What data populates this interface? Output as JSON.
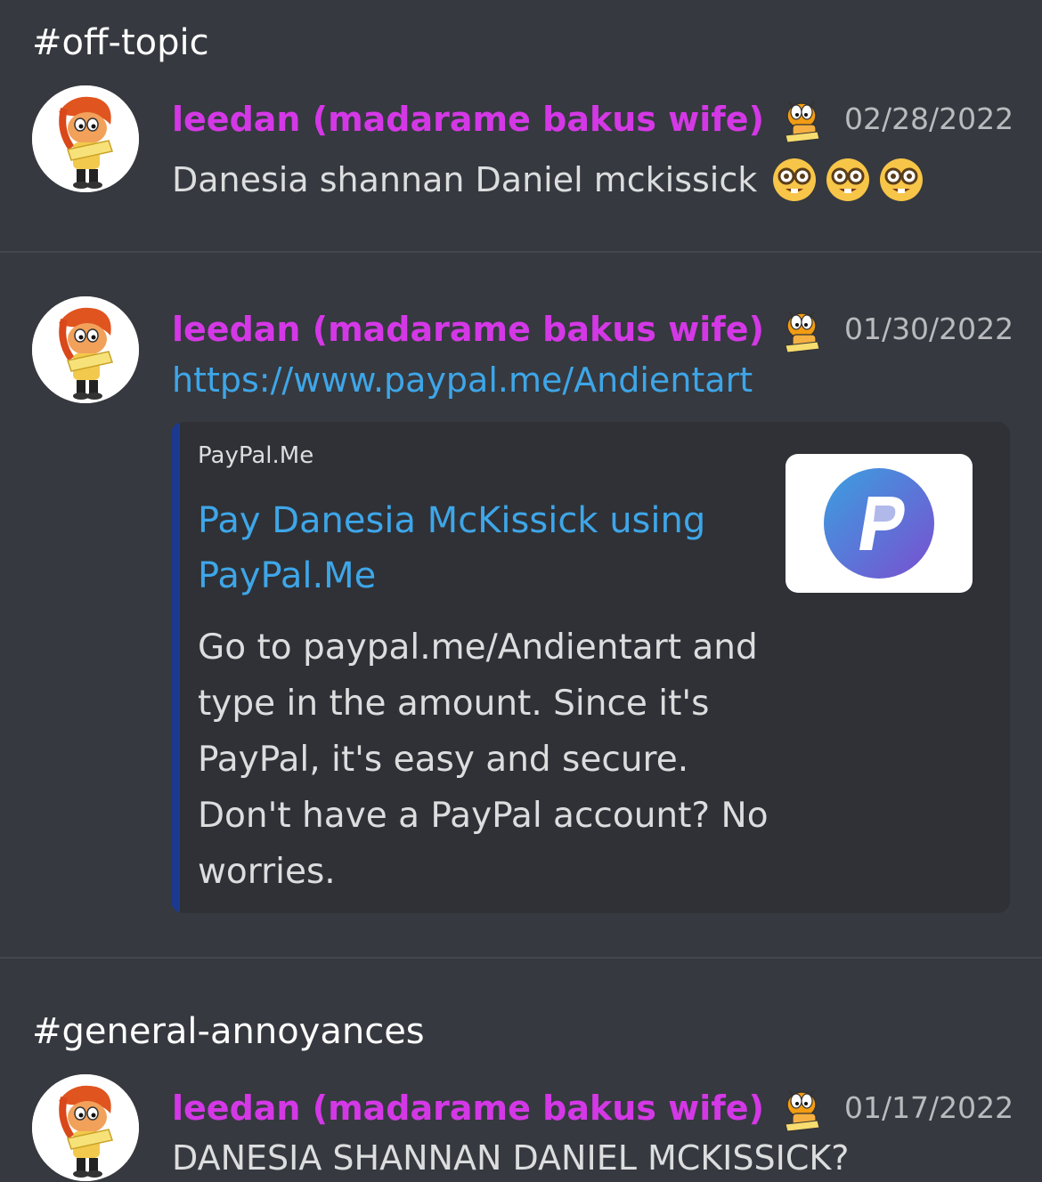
{
  "sections": [
    {
      "channel": "#off-topic",
      "messages": [
        {
          "username": "leedan (madarame bakus wife)",
          "timestamp": "02/28/2022",
          "text": "Danesia shannan Daniel mckissick",
          "emojis": [
            "nerd-face",
            "nerd-face",
            "nerd-face"
          ]
        }
      ]
    },
    {
      "messages": [
        {
          "username": "leedan (madarame bakus wife)",
          "timestamp": "01/30/2022",
          "link": "https://www.paypal.me/Andientart",
          "embed": {
            "provider": "PayPal.Me",
            "title": "Pay Danesia McKissick using PayPal.Me",
            "description": "Go to paypal.me/Andientart and type in the amount. Since it's PayPal, it's easy and secure. Don't have a PayPal account? No worries.",
            "thumbnail_icon": "paypal-logo-icon"
          }
        }
      ]
    },
    {
      "channel": "#general-annoyances",
      "messages": [
        {
          "username": "leedan (madarame bakus wife)",
          "timestamp": "01/17/2022",
          "text": "DANESIA SHANNAN DANIEL MCKISSICK?"
        }
      ]
    }
  ],
  "colors": {
    "background": "#36393f",
    "username": "#d438e6",
    "link": "#3ea6e8",
    "embed_background": "#2f3136",
    "embed_accent_bar": "#1b3a8f"
  }
}
